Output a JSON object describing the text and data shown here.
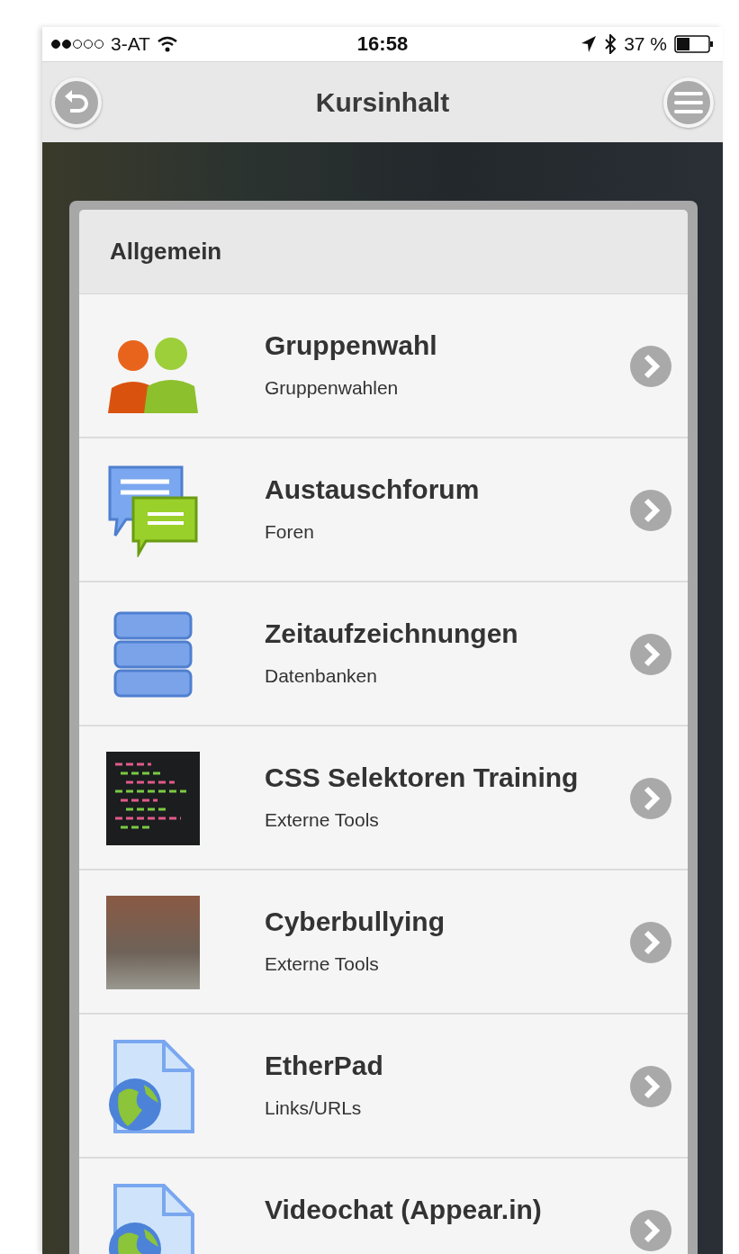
{
  "status_bar": {
    "carrier": "3-AT",
    "time": "16:58",
    "battery": "37 %"
  },
  "nav_bar": {
    "title": "Kursinhalt"
  },
  "section": {
    "title": "Allgemein"
  },
  "items": [
    {
      "title": "Gruppenwahl",
      "subtitle": "Gruppenwahlen",
      "kind": "people"
    },
    {
      "title": "Austauschforum",
      "subtitle": "Foren",
      "kind": "chat"
    },
    {
      "title": "Zeitaufzeichnungen",
      "subtitle": "Datenbanken",
      "kind": "database"
    },
    {
      "title": "CSS Selektoren Training",
      "subtitle": "Externe Tools",
      "kind": "code-photo"
    },
    {
      "title": "Cyberbullying",
      "subtitle": "Externe Tools",
      "kind": "photo"
    },
    {
      "title": "EtherPad",
      "subtitle": "Links/URLs",
      "kind": "document"
    },
    {
      "title": "Videochat (Appear.in)",
      "kind": "document"
    }
  ]
}
